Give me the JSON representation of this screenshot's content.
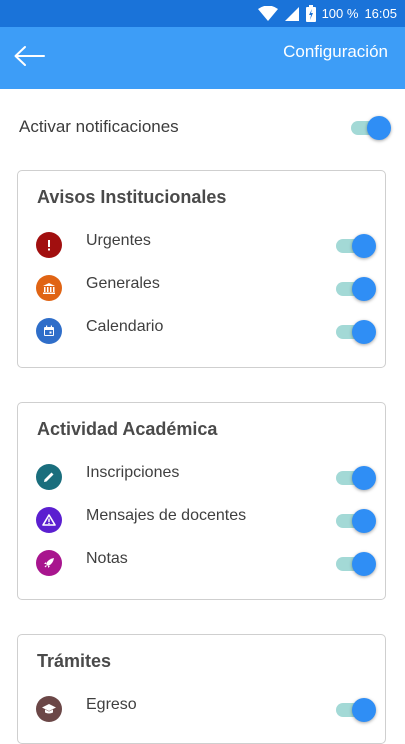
{
  "status_bar": {
    "battery": "100 %",
    "time": "16:05"
  },
  "app_bar": {
    "title": "Configuración"
  },
  "main_toggle": {
    "label": "Activar notificaciones",
    "on": true
  },
  "sections": [
    {
      "title": "Avisos Institucionales",
      "items": [
        {
          "label": "Urgentes",
          "icon": "exclamation-icon",
          "color": "#a10f0f",
          "on": true
        },
        {
          "label": "Generales",
          "icon": "institution-icon",
          "color": "#e06414",
          "on": true
        },
        {
          "label": "Calendario",
          "icon": "calendar-icon",
          "color": "#2f6ec9",
          "on": true
        }
      ]
    },
    {
      "title": "Actividad Académica",
      "items": [
        {
          "label": "Inscripciones",
          "icon": "pencil-icon",
          "color": "#1a6e7d",
          "on": true
        },
        {
          "label": "Mensajes de docentes",
          "icon": "warning-triangle-icon",
          "color": "#5b1fd0",
          "on": true
        },
        {
          "label": "Notas",
          "icon": "rocket-icon",
          "color": "#a8158e",
          "on": true
        }
      ]
    },
    {
      "title": "Trámites",
      "items": [
        {
          "label": "Egreso",
          "icon": "graduation-cap-icon",
          "color": "#6b4747",
          "on": true
        }
      ]
    }
  ],
  "colors": {
    "status_bar": "#1a73d9",
    "app_bar": "#3d9df7",
    "switch_thumb": "#2f8ef5",
    "switch_track": "#a3d9d6"
  }
}
